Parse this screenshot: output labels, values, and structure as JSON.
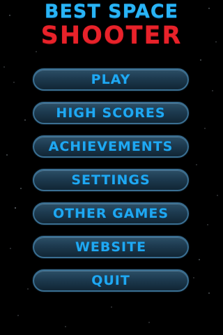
{
  "title": {
    "line1": "BEST SPACE",
    "line2": "SHOOTER"
  },
  "menu": {
    "items": [
      {
        "label": "PLAY"
      },
      {
        "label": "HIGH SCORES"
      },
      {
        "label": "ACHIEVEMENTS"
      },
      {
        "label": "SETTINGS"
      },
      {
        "label": "OTHER GAMES"
      },
      {
        "label": "WEBSITE"
      },
      {
        "label": "QUIT"
      }
    ]
  },
  "colors": {
    "background": "#000000",
    "title_line1": "#29b4f5",
    "title_line2": "#e8222a",
    "button_text": "#1fa8f2",
    "button_border": "#3a6f92",
    "button_fill": "#1d3a4f"
  }
}
